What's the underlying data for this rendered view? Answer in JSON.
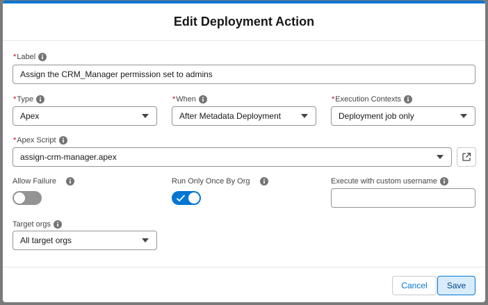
{
  "modal": {
    "title": "Edit Deployment Action"
  },
  "fields": {
    "label": {
      "label": "Label",
      "required_mark": "*",
      "value": "Assign the CRM_Manager permission set to admins"
    },
    "type": {
      "label": "Type",
      "required_mark": "*",
      "value": "Apex"
    },
    "when": {
      "label": "When",
      "required_mark": "*",
      "value": "After Metadata Deployment"
    },
    "execution_contexts": {
      "label": "Execution Contexts",
      "required_mark": "*",
      "value": "Deployment job only"
    },
    "apex_script": {
      "label": "Apex Script",
      "required_mark": "*",
      "value": "assign-crm-manager.apex"
    },
    "allow_failure": {
      "label": "Allow Failure",
      "checked": false
    },
    "run_once": {
      "label": "Run Only Once By Org",
      "checked": true
    },
    "custom_username": {
      "label": "Execute with custom username",
      "value": ""
    },
    "target_orgs": {
      "label": "Target orgs",
      "value": "All target orgs"
    }
  },
  "footer": {
    "cancel_label": "Cancel",
    "save_label": "Save"
  },
  "colors": {
    "brand": "#0176d3",
    "required": "#ba0517",
    "toggle_off": "#939393"
  },
  "icons": {
    "info": "info-icon",
    "dropdown": "chevron-down-icon",
    "open": "external-link-icon",
    "check": "check-icon"
  }
}
